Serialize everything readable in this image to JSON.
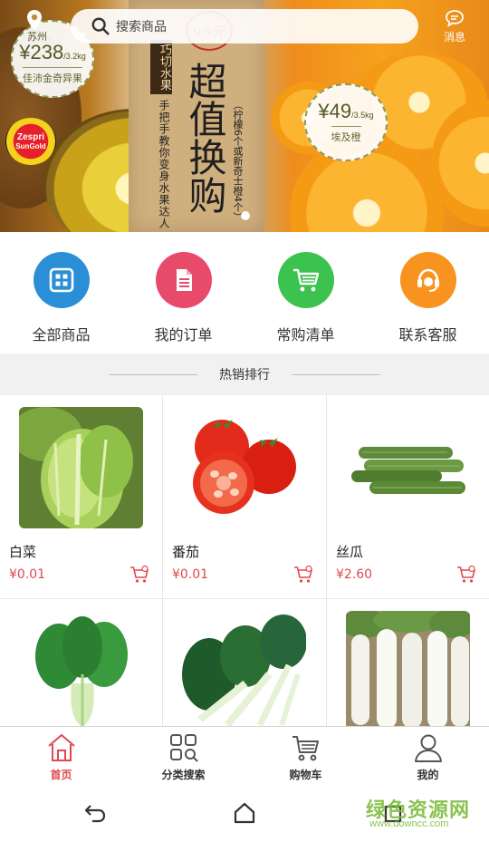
{
  "header": {
    "search_placeholder": "搜索商品",
    "messages_label": "消息"
  },
  "banner": {
    "left_badge": {
      "city": "苏州",
      "price": "¥238",
      "unit": "/3.2kg",
      "name": "佳沛金奇异果"
    },
    "right_badge": {
      "price": "¥49",
      "unit": "/3.5kg",
      "name": "埃及橙"
    },
    "brand_logo": {
      "line1": "Zespri",
      "line2": "SunGold"
    },
    "poster_price": "9.9元",
    "poster_tag": "巧切水果",
    "poster_subtitle": "手把手教你变身水果达人",
    "poster_title": "超值换购",
    "poster_note": "（柠檬6个或新奇士橙4个）"
  },
  "quick_menu": [
    {
      "label": "全部商品",
      "icon": "grid-icon",
      "color": "#2a8fd6"
    },
    {
      "label": "我的订单",
      "icon": "document-icon",
      "color": "#e84a6a"
    },
    {
      "label": "常购清单",
      "icon": "cart-icon",
      "color": "#3cc24e"
    },
    {
      "label": "联系客服",
      "icon": "headset-icon",
      "color": "#f7931e"
    }
  ],
  "section": {
    "title": "热销排行"
  },
  "products": [
    {
      "name": "白菜",
      "price": "¥0.01"
    },
    {
      "name": "番茄",
      "price": "¥0.01"
    },
    {
      "name": "丝瓜",
      "price": "¥2.60"
    },
    {
      "name": "",
      "price": ""
    },
    {
      "name": "",
      "price": ""
    },
    {
      "name": "",
      "price": ""
    }
  ],
  "tabbar": [
    {
      "label": "首页",
      "icon": "home-icon",
      "active": true
    },
    {
      "label": "分类搜索",
      "icon": "category-search-icon",
      "active": false
    },
    {
      "label": "购物车",
      "icon": "shopping-cart-icon",
      "active": false
    },
    {
      "label": "我的",
      "icon": "user-icon",
      "active": false
    }
  ],
  "watermark": {
    "line1": "绿色资源网",
    "line2": "www.downcc.com"
  },
  "colors": {
    "accent": "#e0484f",
    "divider": "#e8e8e8"
  }
}
